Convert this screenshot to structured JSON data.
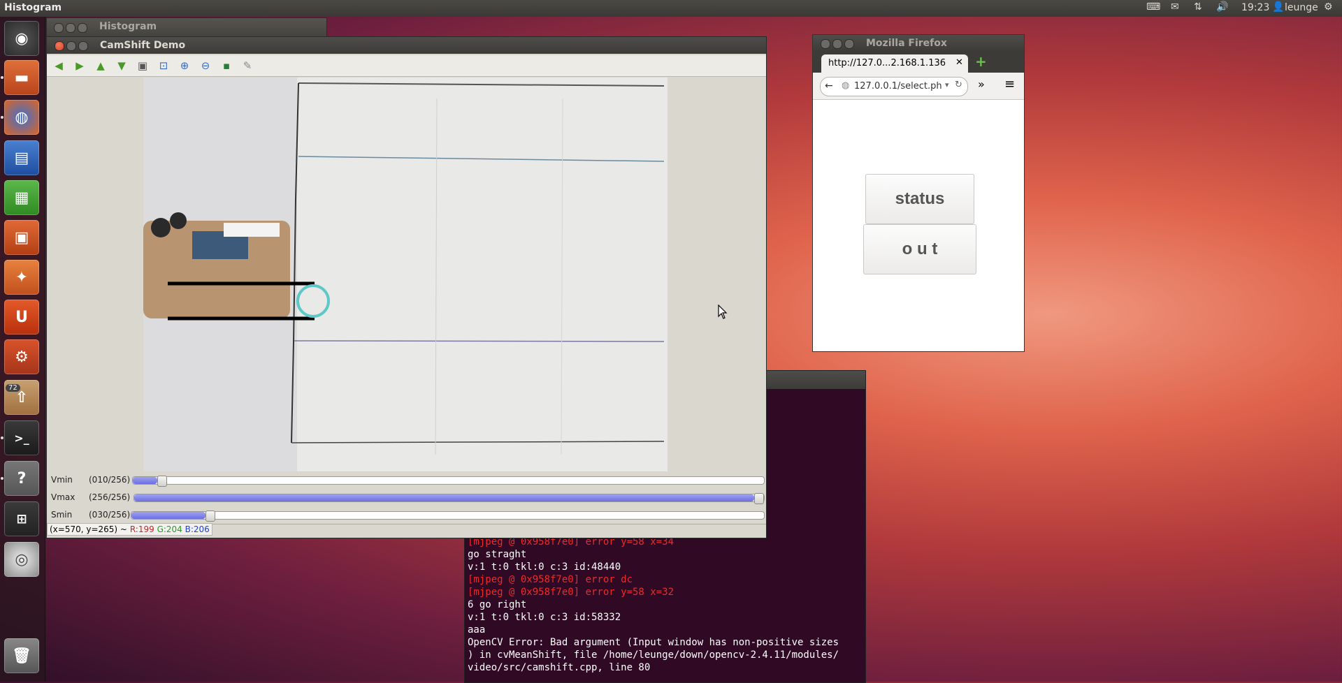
{
  "top_panel": {
    "active_app": "Histogram",
    "time": "19:23",
    "user": "leunge"
  },
  "launcher": {
    "items": [
      "dash-home",
      "files",
      "firefox",
      "writer",
      "calc",
      "impress",
      "software-center",
      "ubuntu-one",
      "system-settings",
      "update-manager",
      "terminal",
      "help",
      "workspace-switcher",
      "dvd",
      "trash"
    ],
    "update_badge": "72"
  },
  "histogram_window": {
    "title": "Histogram"
  },
  "camshift_window": {
    "title": "CamShift Demo",
    "sliders": [
      {
        "name": "Vmin",
        "value_text": "(010/256)",
        "value": 10,
        "max": 256
      },
      {
        "name": "Vmax",
        "value_text": "(256/256)",
        "value": 256,
        "max": 256
      },
      {
        "name": "Smin",
        "value_text": "(030/256)",
        "value": 30,
        "max": 256
      }
    ],
    "status": {
      "coords": "(x=570, y=265) ~",
      "r": "R:199",
      "g": "G:204",
      "b": "B:206"
    }
  },
  "terminal": {
    "lines": [
      {
        "text": "[mjpeg @ 0x958f7e0] error y=58 x=34",
        "color": "#ef2929"
      },
      {
        "text": "go straght",
        "color": "#ffffff"
      },
      {
        "text": "v:1 t:0 tkl:0 c:3 id:48440",
        "color": "#ffffff"
      },
      {
        "text": "[mjpeg @ 0x958f7e0] error dc",
        "color": "#ef2929"
      },
      {
        "text": "[mjpeg @ 0x958f7e0] error y=58 x=32",
        "color": "#ef2929"
      },
      {
        "text": "6 go right",
        "color": "#ffffff"
      },
      {
        "text": "v:1 t:0 tkl:0 c:3 id:58332",
        "color": "#ffffff"
      },
      {
        "text": "aaa",
        "color": "#ffffff"
      },
      {
        "text": "OpenCV Error: Bad argument (Input window has non-positive sizes",
        "color": "#ffffff"
      },
      {
        "text": ") in cvMeanShift, file /home/leunge/down/opencv-2.4.11/modules/",
        "color": "#ffffff"
      },
      {
        "text": "video/src/camshift.cpp, line 80",
        "color": "#ffffff"
      }
    ]
  },
  "firefox_window": {
    "title": "Mozilla Firefox",
    "tab_title": "http://127.0...2.168.1.136",
    "url": "127.0.0.1/select.ph",
    "buttons": {
      "status": "status",
      "out": "o u t"
    }
  }
}
